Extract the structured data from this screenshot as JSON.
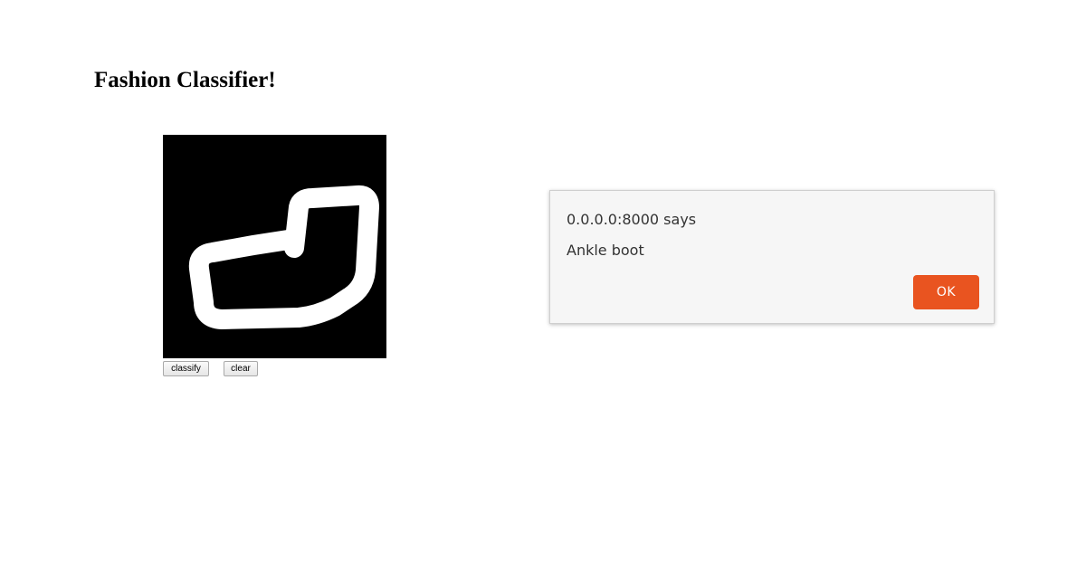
{
  "page": {
    "title": "Fashion Classifier!"
  },
  "controls": {
    "classify_label": "classify",
    "clear_label": "clear"
  },
  "alert": {
    "origin": "0.0.0.0:8000 says",
    "message": "Ankle boot",
    "ok_label": "OK",
    "ok_color": "#e95420"
  },
  "drawing_canvas": {
    "background": "#000000",
    "stroke_color": "#ffffff"
  }
}
